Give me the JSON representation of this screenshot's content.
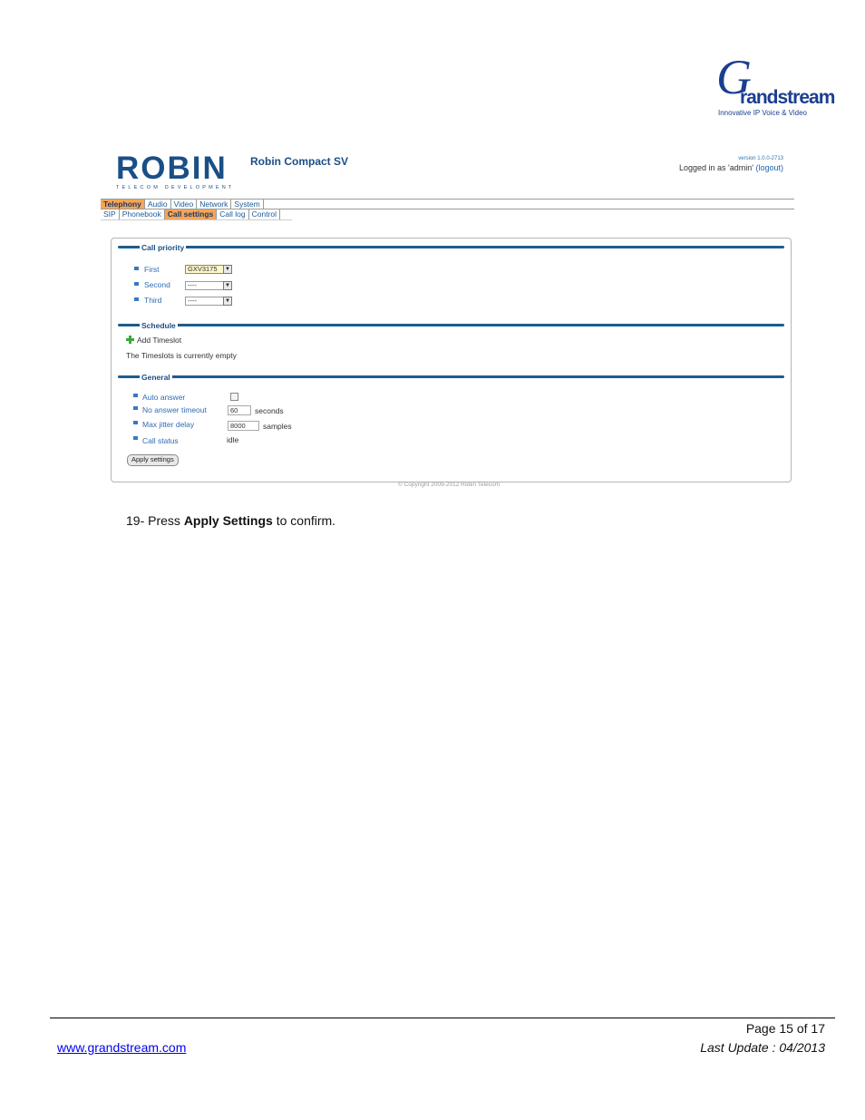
{
  "grandstream_logo": {
    "letter": "G",
    "word": "randstream",
    "tagline": "Innovative IP Voice & Video"
  },
  "header": {
    "logo_word": "ROBIN",
    "logo_sub": "TELECOM DEVELOPMENT",
    "product": "Robin Compact SV",
    "version": "version 1.0.0-2713",
    "logged_in": "Logged in as 'admin'",
    "logout": "(logout)"
  },
  "main_menu": [
    "Telephony",
    "Audio",
    "Video",
    "Network",
    "System"
  ],
  "main_menu_active": "Telephony",
  "sub_menu": [
    "SIP",
    "Phonebook",
    "Call settings",
    "Call log",
    "Control"
  ],
  "sub_menu_active": "Call settings",
  "call_priority": {
    "title": "Call priority",
    "items": [
      {
        "label": "First",
        "value": "GXV3175"
      },
      {
        "label": "Second",
        "value": "----"
      },
      {
        "label": "Third",
        "value": "----"
      }
    ]
  },
  "schedule": {
    "title": "Schedule",
    "add_label": "Add Timeslot",
    "empty_text": "The Timeslots is currently empty"
  },
  "general": {
    "title": "General",
    "auto_answer_label": "Auto answer",
    "auto_answer_checked": false,
    "no_answer_label": "No answer timeout",
    "no_answer_value": "60",
    "no_answer_unit": "seconds",
    "jitter_label": "Max jitter delay",
    "jitter_value": "8000",
    "jitter_unit": "samples",
    "status_label": "Call status",
    "status_value": "idle",
    "apply_button": "Apply settings"
  },
  "copyright": "© Copyright 2009-2012 Robin Telecom",
  "instruction": {
    "prefix": "19- Press ",
    "bold": "Apply Settings",
    "suffix": " to confirm."
  },
  "footer": {
    "page": "Page 15 of 17",
    "link": "www.grandstream.com",
    "last_update": "Last Update : 04/2013"
  }
}
